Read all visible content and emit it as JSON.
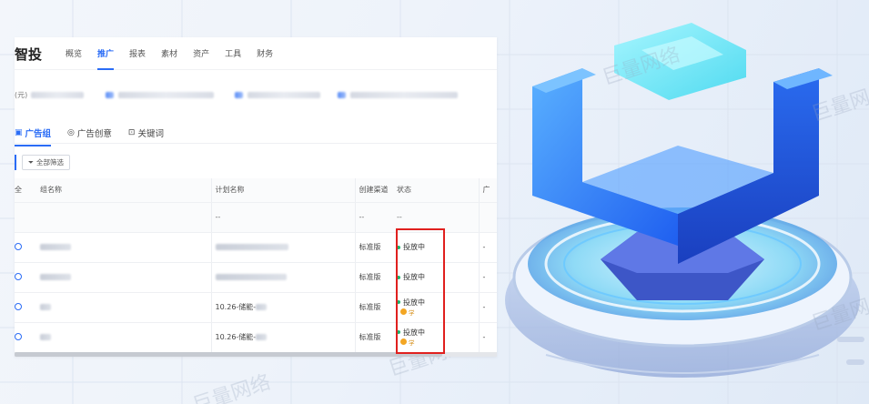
{
  "app": {
    "brand": "智投"
  },
  "nav": [
    {
      "label": "概览",
      "active": false
    },
    {
      "label": "推广",
      "active": true
    },
    {
      "label": "报表",
      "active": false
    },
    {
      "label": "素材",
      "active": false
    },
    {
      "label": "资产",
      "active": false
    },
    {
      "label": "工具",
      "active": false
    },
    {
      "label": "财务",
      "active": false
    }
  ],
  "summary": {
    "label": "(元)"
  },
  "tabs": [
    {
      "label": "广告组",
      "icon": "ad-group-icon",
      "active": true
    },
    {
      "label": "广告创意",
      "icon": "lightbulb-icon",
      "active": false
    },
    {
      "label": "关键词",
      "icon": "keyword-icon",
      "active": false
    }
  ],
  "filter": {
    "label": "全部筛选",
    "icon": "filter-icon"
  },
  "table": {
    "headers": [
      "全",
      "组名称",
      "计划名称",
      "创建渠道",
      "状态",
      "广"
    ],
    "filter_row": [
      "--",
      "--",
      "--"
    ],
    "rows": [
      {
        "plan": "",
        "channel": "标准版",
        "status": "投放中",
        "learning": false,
        "learn_label": "",
        "extra": "-"
      },
      {
        "plan": "",
        "channel": "标准版",
        "status": "投放中",
        "learning": false,
        "learn_label": "",
        "extra": "-"
      },
      {
        "plan": "10.26-储能-",
        "channel": "标准版",
        "status": "投放中",
        "learning": true,
        "learn_label": "学",
        "extra": "-"
      },
      {
        "plan": "10.26-储能-",
        "channel": "标准版",
        "status": "投放中",
        "learning": true,
        "learn_label": "学",
        "extra": "-"
      }
    ]
  },
  "watermark": "巨量网络",
  "colors": {
    "accent": "#2a6cf6",
    "status_green": "#20b26b",
    "highlight": "#e0201e",
    "learning": "#f3a623"
  }
}
